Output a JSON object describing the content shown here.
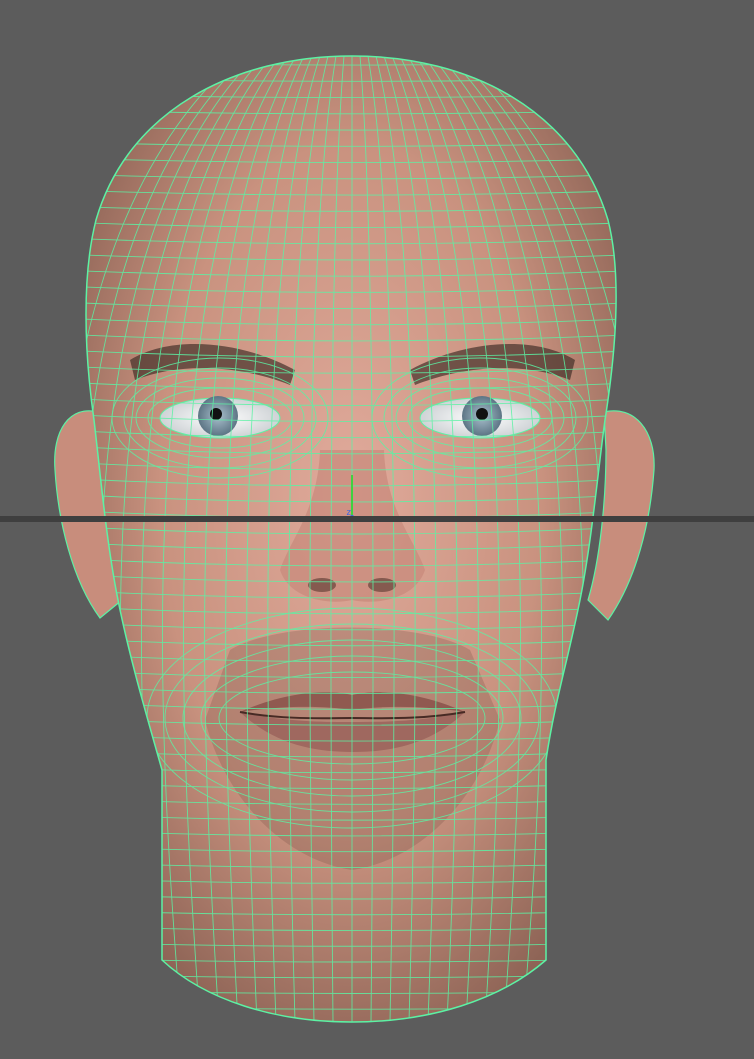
{
  "viewport": {
    "background_color": "#5c5c5c",
    "wireframe_color": "#5cf2a4",
    "skin_color": "#d9a395",
    "iris_color": "#7f98a8"
  },
  "gizmo": {
    "axis_z_label": "z",
    "x_color": "#e03a2f",
    "y_color": "#3fd13f",
    "z_color": "#3a66e0"
  }
}
